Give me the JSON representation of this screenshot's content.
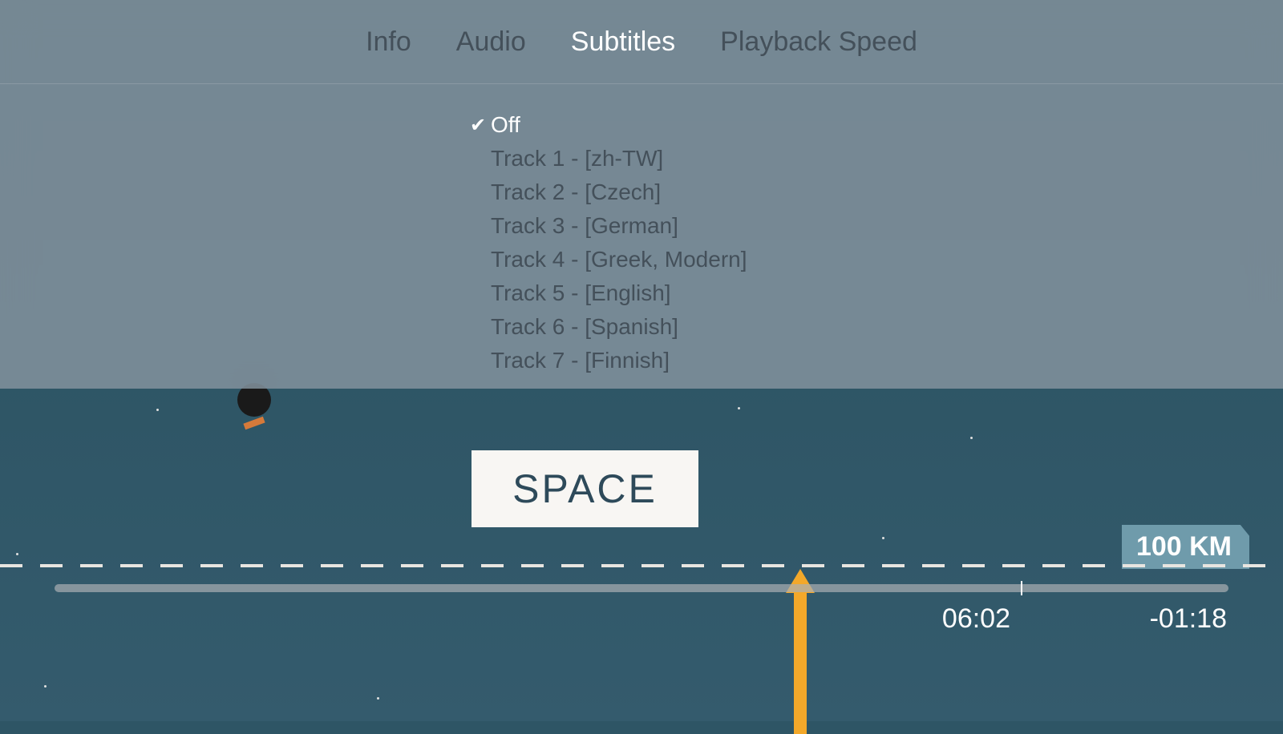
{
  "tabs": {
    "info": "Info",
    "audio": "Audio",
    "subtitles": "Subtitles",
    "playback_speed": "Playback Speed"
  },
  "subtitle_options": [
    {
      "label": "Off",
      "selected": true
    },
    {
      "label": "Track 1 - [zh-TW]",
      "selected": false
    },
    {
      "label": "Track 2 - [Czech]",
      "selected": false
    },
    {
      "label": "Track 3 - [German]",
      "selected": false
    },
    {
      "label": "Track 4 - [Greek, Modern]",
      "selected": false
    },
    {
      "label": "Track 5 - [English]",
      "selected": false
    },
    {
      "label": "Track 6 - [Spanish]",
      "selected": false
    },
    {
      "label": "Track 7 - [Finnish]",
      "selected": false
    }
  ],
  "video_content": {
    "space_label": "SPACE",
    "distance_label": "100 KM"
  },
  "playback": {
    "elapsed": "06:02",
    "remaining": "-01:18",
    "progress_percent": 82.3
  },
  "checkmark_glyph": "✔"
}
